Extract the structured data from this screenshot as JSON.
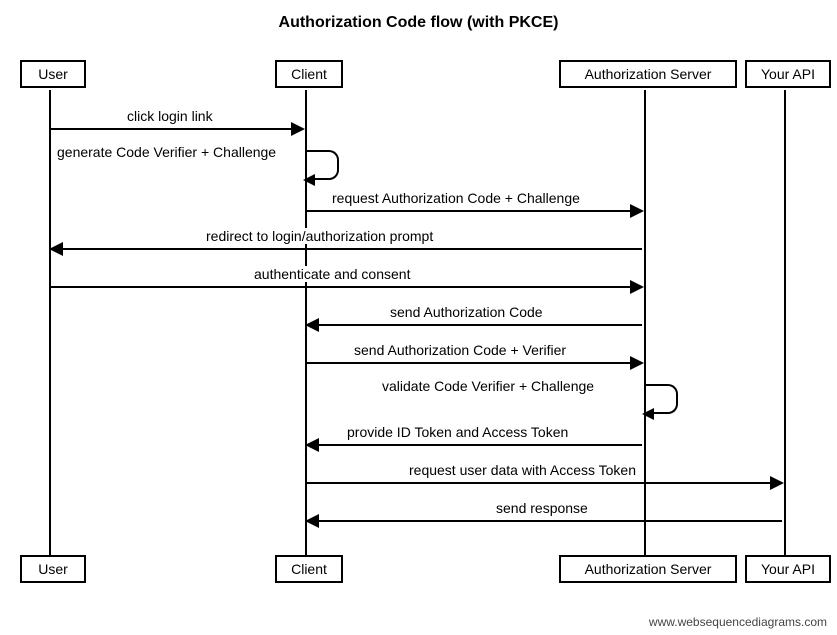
{
  "title": "Authorization Code flow (with PKCE)",
  "participants": {
    "user": "User",
    "client": "Client",
    "auth": "Authorization Server",
    "api": "Your API"
  },
  "messages": {
    "m1": "click login link",
    "m2": "generate Code Verifier + Challenge",
    "m3": "request Authorization Code + Challenge",
    "m4": "redirect to login/authorization prompt",
    "m5": "authenticate and consent",
    "m6": "send Authorization Code",
    "m7": "send Authorization Code + Verifier",
    "m8": "validate Code Verifier + Challenge",
    "m9": "provide ID Token and Access Token",
    "m10": "request user data with Access Token",
    "m11": "send response"
  },
  "footer": "www.websequencediagrams.com"
}
